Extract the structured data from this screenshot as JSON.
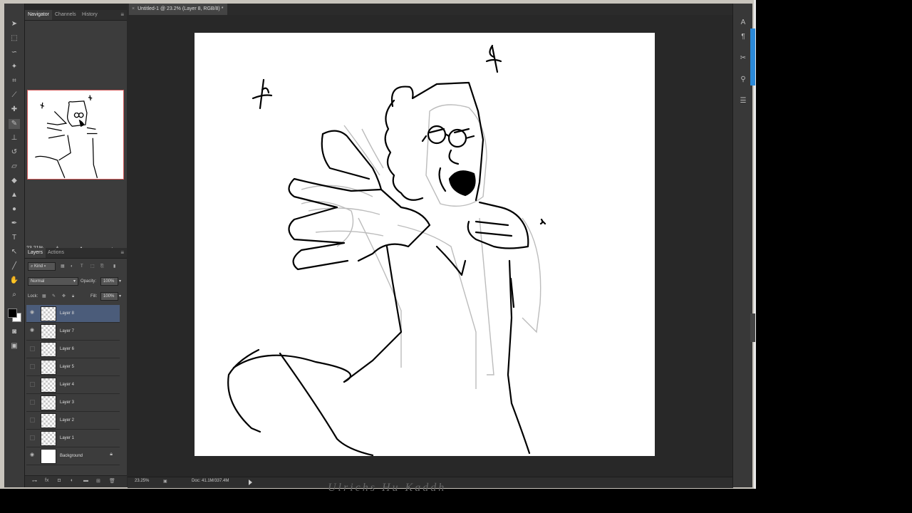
{
  "document": {
    "tab_title": "Untitled-1 @ 23.2% (Layer 8, RGB/8) *"
  },
  "navigator": {
    "tabs": [
      "Navigator",
      "Channels",
      "History"
    ],
    "zoom": "23.21%"
  },
  "layers_panel": {
    "tabs": [
      "Layers",
      "Actions"
    ],
    "kind_label": "Kind",
    "blend_mode": "Normal",
    "opacity_label": "Opacity:",
    "opacity_value": "100%",
    "lock_label": "Lock:",
    "fill_label": "Fill:",
    "fill_value": "100%",
    "layers": [
      {
        "name": "Layer 8",
        "visible": true,
        "selected": true
      },
      {
        "name": "Layer 7",
        "visible": true,
        "selected": false
      },
      {
        "name": "Layer 6",
        "visible": false,
        "selected": false
      },
      {
        "name": "Layer 5",
        "visible": false,
        "selected": false
      },
      {
        "name": "Layer 4",
        "visible": false,
        "selected": false
      },
      {
        "name": "Layer 3",
        "visible": false,
        "selected": false
      },
      {
        "name": "Layer 2",
        "visible": false,
        "selected": false
      },
      {
        "name": "Layer 1",
        "visible": false,
        "selected": false
      },
      {
        "name": "Background",
        "visible": true,
        "selected": false
      }
    ]
  },
  "status": {
    "zoom": "23.25%",
    "doc_size": "Doc: 41.1M/337.4M"
  },
  "background_text": "Ulrichs Hu Kaddh",
  "colors": {
    "foreground": "#000000",
    "background": "#ffffff",
    "selection": "#4b5c7a"
  }
}
